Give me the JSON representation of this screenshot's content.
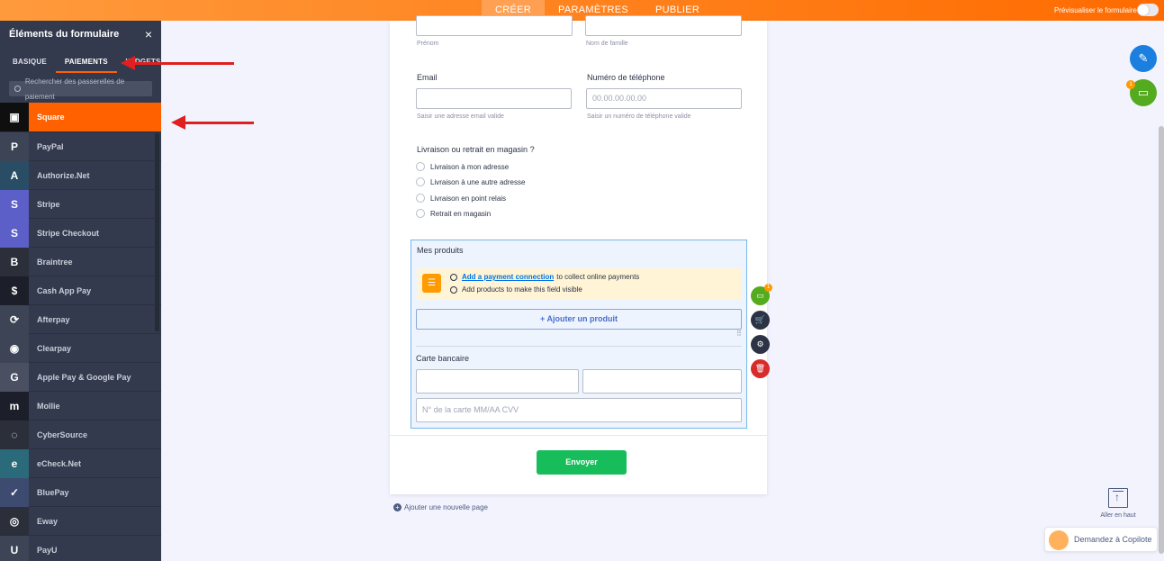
{
  "topbar": {
    "tabs": [
      "CRÉER",
      "PARAMÈTRES",
      "PUBLIER"
    ],
    "preview_label": "Prévisualiser le formulaire"
  },
  "sidebar": {
    "title": "Éléments du formulaire",
    "close_icon": "×",
    "tabs": [
      "BASIQUE",
      "PAIEMENTS",
      "WIDGETS"
    ],
    "search_placeholder": "Rechercher des passerelles de paiement",
    "items": [
      {
        "label": "Square",
        "icon": "square-logo-icon",
        "glyph": "▣",
        "color": "#0f0f0f"
      },
      {
        "label": "PayPal",
        "icon": "paypal-logo-icon",
        "glyph": "P",
        "color": "#3d4455"
      },
      {
        "label": "Authorize.Net",
        "icon": "authorize-net-logo-icon",
        "glyph": "A",
        "color": "#2a4d66"
      },
      {
        "label": "Stripe",
        "icon": "stripe-logo-icon",
        "glyph": "S",
        "color": "#5b5fc7"
      },
      {
        "label": "Stripe Checkout",
        "icon": "stripe-checkout-logo-icon",
        "glyph": "S",
        "color": "#5b5fc7"
      },
      {
        "label": "Braintree",
        "icon": "braintree-logo-icon",
        "glyph": "B",
        "color": "#2b2f3a"
      },
      {
        "label": "Cash App Pay",
        "icon": "cash-app-logo-icon",
        "glyph": "$",
        "color": "#1c1f29"
      },
      {
        "label": "Afterpay",
        "icon": "afterpay-logo-icon",
        "glyph": "⟳",
        "color": "#3d4455"
      },
      {
        "label": "Clearpay",
        "icon": "clearpay-logo-icon",
        "glyph": "◉",
        "color": "#3d4455"
      },
      {
        "label": "Apple Pay & Google Pay",
        "icon": "apple-google-pay-logo-icon",
        "glyph": "G",
        "color": "#4a5062"
      },
      {
        "label": "Mollie",
        "icon": "mollie-logo-icon",
        "glyph": "m",
        "color": "#1c1f29"
      },
      {
        "label": "CyberSource",
        "icon": "cybersource-logo-icon",
        "glyph": "◌",
        "color": "#2b2f3a"
      },
      {
        "label": "eCheck.Net",
        "icon": "echeck-logo-icon",
        "glyph": "e",
        "color": "#2a6a7a"
      },
      {
        "label": "BluePay",
        "icon": "bluepay-logo-icon",
        "glyph": "✓",
        "color": "#3d4b70"
      },
      {
        "label": "Eway",
        "icon": "eway-logo-icon",
        "glyph": "◎",
        "color": "#2b2f3a"
      },
      {
        "label": "PayU",
        "icon": "payu-logo-icon",
        "glyph": "U",
        "color": "#3d4455"
      }
    ]
  },
  "form": {
    "first_name_sub": "Prénom",
    "last_name_sub": "Nom de famille",
    "email_label": "Email",
    "email_sub": "Saisir une adresse email valide",
    "phone_label": "Numéro de téléphone",
    "phone_placeholder": "00.00.00.00.00",
    "phone_sub": "Saisir un numéro de téléphone valide",
    "delivery_question": "Livraison ou retrait en magasin ?",
    "delivery_options": [
      "Livraison à mon adresse",
      "Livraison à une autre adresse",
      "Livraison en point relais",
      "Retrait en magasin"
    ],
    "products_title": "Mes produits",
    "banner_link": "Add a payment connection",
    "banner_text1": "to collect online payments",
    "banner_text2": "Add products to make this field visible",
    "add_product": "+ Ajouter un produit",
    "card_label": "Carte bancaire",
    "card_placeholder": "N° de la carte   MM/AA   CVV",
    "submit": "Envoyer",
    "add_page": "Ajouter une nouvelle page"
  },
  "tools": {
    "badge_count": "1"
  },
  "footer": {
    "go_top": "Aller en haut",
    "copilot": "Demandez à Copilote"
  },
  "colors": {
    "accent": "#ff6100",
    "sidebar_bg": "#333a4d",
    "submit": "#18bd5b"
  }
}
